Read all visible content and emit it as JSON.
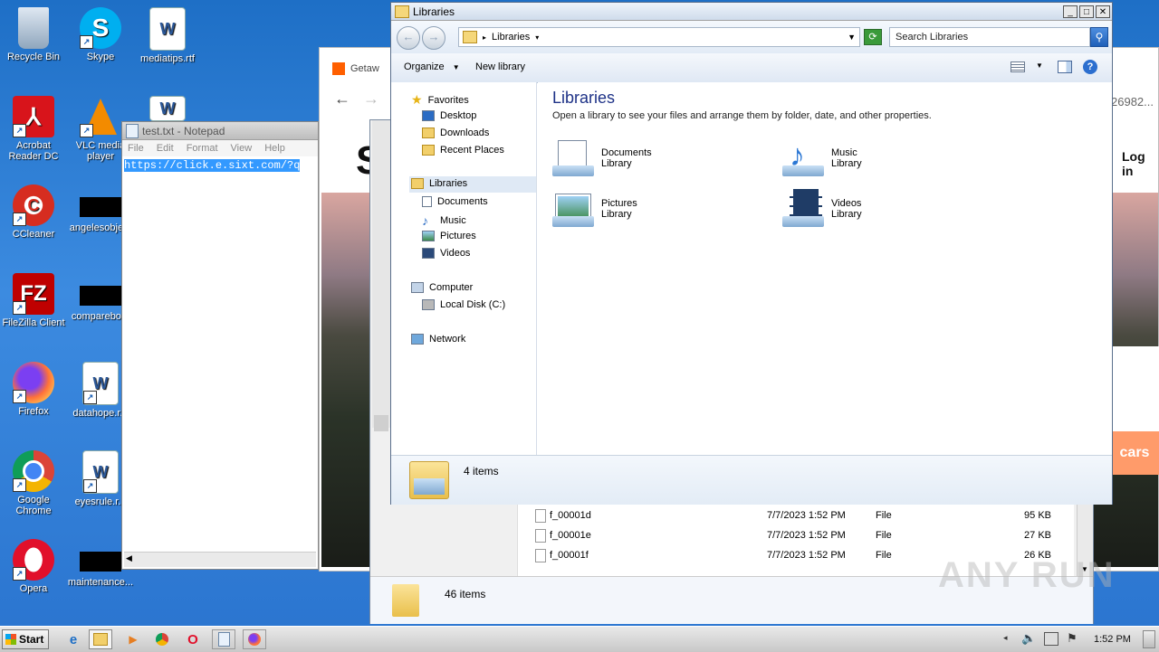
{
  "desktop": {
    "icons": [
      {
        "label": "Recycle Bin",
        "icon": "recycle-bin-icon"
      },
      {
        "label": "Skype",
        "icon": "skype-icon"
      },
      {
        "label": "mediatips.rtf",
        "icon": "word-document-icon"
      },
      {
        "label": "Acrobat Reader DC",
        "icon": "acrobat-icon"
      },
      {
        "label": "VLC media player",
        "icon": "vlc-icon"
      },
      {
        "label": "CCleaner",
        "icon": "ccleaner-icon"
      },
      {
        "label": "angelesobje...",
        "icon": "redacted-file-icon"
      },
      {
        "label": "FileZilla Client",
        "icon": "filezilla-icon"
      },
      {
        "label": "comparebo...",
        "icon": "redacted-file-icon"
      },
      {
        "label": "Firefox",
        "icon": "firefox-icon"
      },
      {
        "label": "datahope.r...",
        "icon": "word-document-icon"
      },
      {
        "label": "Google Chrome",
        "icon": "chrome-icon"
      },
      {
        "label": "eyesrule.r...",
        "icon": "word-document-icon"
      },
      {
        "label": "Opera",
        "icon": "opera-icon"
      },
      {
        "label": "maintenance...",
        "icon": "redacted-file-icon"
      }
    ]
  },
  "notepad": {
    "title": "test.txt - Notepad",
    "menu": [
      "File",
      "Edit",
      "Format",
      "View",
      "Help"
    ],
    "content": "https://click.e.sixt.com/?q"
  },
  "browser": {
    "tab_label": "Getaw",
    "url_fragment": "26982...",
    "login": "Log in",
    "cars_button": "cars",
    "logo_letter": "S"
  },
  "explorer_behind": {
    "files": [
      {
        "name": "f_00001d",
        "date": "7/7/2023 1:52 PM",
        "type": "File",
        "size": "95 KB"
      },
      {
        "name": "f_00001e",
        "date": "7/7/2023 1:52 PM",
        "type": "File",
        "size": "27 KB"
      },
      {
        "name": "f_00001f",
        "date": "7/7/2023 1:52 PM",
        "type": "File",
        "size": "26 KB"
      }
    ],
    "status": "46 items"
  },
  "libraries_window": {
    "title": "Libraries",
    "breadcrumb": "Libraries",
    "search_placeholder": "Search Libraries",
    "toolbar": {
      "organize": "Organize",
      "new_library": "New library"
    },
    "nav": {
      "favorites": "Favorites",
      "desktop": "Desktop",
      "downloads": "Downloads",
      "recent": "Recent Places",
      "libraries": "Libraries",
      "documents": "Documents",
      "music": "Music",
      "pictures": "Pictures",
      "videos": "Videos",
      "computer": "Computer",
      "local_disk": "Local Disk (C:)",
      "network": "Network"
    },
    "heading": "Libraries",
    "description": "Open a library to see your files and arrange them by folder, date, and other properties.",
    "libraries": [
      {
        "name": "Documents",
        "sub": "Library",
        "icon": "documents-library-icon"
      },
      {
        "name": "Music",
        "sub": "Library",
        "icon": "music-library-icon"
      },
      {
        "name": "Pictures",
        "sub": "Library",
        "icon": "pictures-library-icon"
      },
      {
        "name": "Videos",
        "sub": "Library",
        "icon": "videos-library-icon"
      }
    ],
    "status": "4 items"
  },
  "taskbar": {
    "start": "Start",
    "clock": "1:52 PM"
  },
  "watermark": "ANY RUN"
}
